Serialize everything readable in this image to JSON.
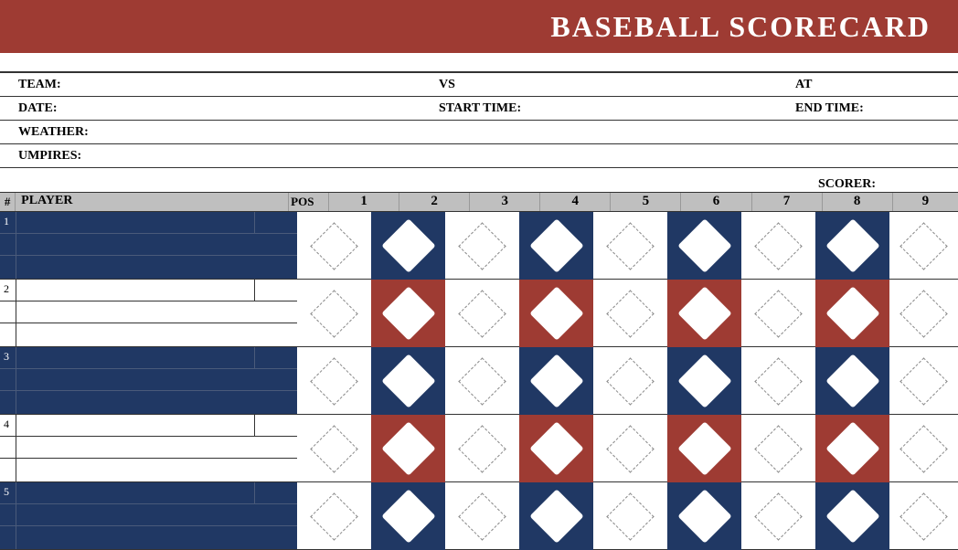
{
  "title": "BASEBALL SCORECARD",
  "info": {
    "team_label": "TEAM:",
    "vs_label": "VS",
    "at_label": "AT",
    "date_label": "DATE:",
    "start_time_label": "START TIME:",
    "end_time_label": "END TIME:",
    "weather_label": "WEATHER:",
    "umpires_label": "UMPIRES:",
    "scorer_label": "SCORER:"
  },
  "columns": {
    "num": "#",
    "player": "PLAYER",
    "pos": "POS",
    "innings": [
      "1",
      "2",
      "3",
      "4",
      "5",
      "6",
      "7",
      "8",
      "9"
    ]
  },
  "rows": [
    {
      "num": "1",
      "style": "dark",
      "pattern": [
        "open",
        "blue",
        "open",
        "blue",
        "open",
        "blue",
        "open",
        "blue",
        "open"
      ]
    },
    {
      "num": "2",
      "style": "light",
      "pattern": [
        "open",
        "red",
        "open",
        "red",
        "open",
        "red",
        "open",
        "red",
        "open"
      ]
    },
    {
      "num": "3",
      "style": "dark",
      "pattern": [
        "open",
        "blue",
        "open",
        "blue",
        "open",
        "blue",
        "open",
        "blue",
        "open"
      ]
    },
    {
      "num": "4",
      "style": "light",
      "pattern": [
        "open",
        "red",
        "open",
        "red",
        "open",
        "red",
        "open",
        "red",
        "open"
      ]
    },
    {
      "num": "5",
      "style": "dark",
      "pattern": [
        "open",
        "blue",
        "open",
        "blue",
        "open",
        "blue",
        "open",
        "blue",
        "open"
      ]
    }
  ],
  "colors": {
    "brand_red": "#9e3b33",
    "brand_blue": "#203864",
    "header_gray": "#bfbfbf"
  }
}
